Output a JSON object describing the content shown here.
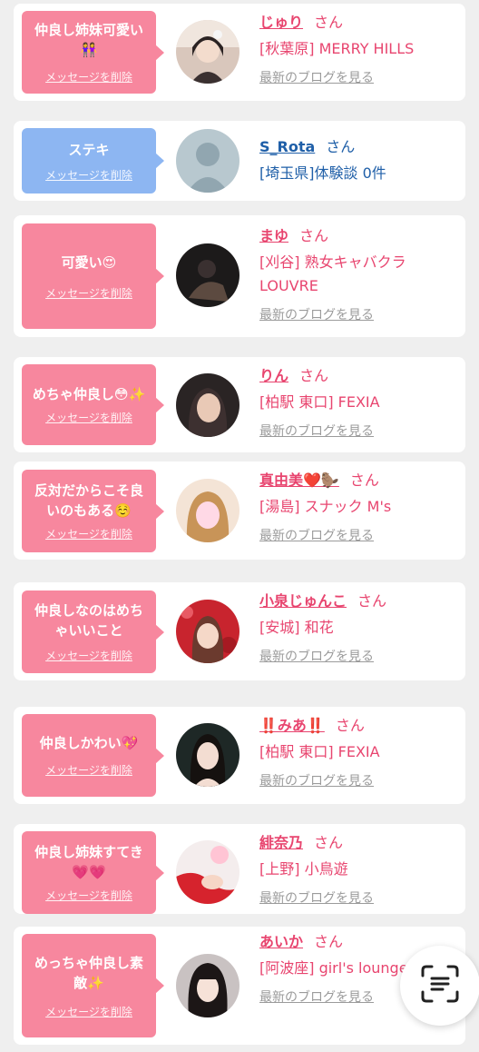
{
  "delete_label": "メッセージを削除",
  "blog_label": "最新のブログを見る",
  "honorific": "さん",
  "colors": {
    "pink": "#f7879e",
    "blue": "#8db6f2",
    "name_pink": "#e8456f",
    "name_blue": "#1f5fa8"
  },
  "messages": [
    {
      "text": "仲良し姉妹可愛い👭",
      "name": "じゅり",
      "shop": "[秋葉原] MERRY HILLS",
      "blog": true,
      "color": "pink"
    },
    {
      "text": "ステキ",
      "name": "S_Rota",
      "shop": "[埼玉県]体験談 0件",
      "blog": false,
      "color": "blue"
    },
    {
      "text": "可愛い😍",
      "name": "まゆ",
      "shop": "[刈谷] 熟女キャバクラLOUVRE",
      "blog": true,
      "color": "pink"
    },
    {
      "text": "めちゃ仲良し😳✨",
      "name": "りん",
      "shop": "[柏駅 東口] FEXIA",
      "blog": true,
      "color": "pink"
    },
    {
      "text": "反対だからこそ良いのもある☺️",
      "name": "真由美❤️🦫",
      "shop": "[湯島] スナック M's",
      "blog": true,
      "color": "pink"
    },
    {
      "text": "仲良しなのはめちゃいいこと",
      "name": "小泉じゅんこ",
      "shop": "[安城] 和花",
      "blog": true,
      "color": "pink"
    },
    {
      "text": "仲良しかわい💖",
      "name": "‼️みあ‼️",
      "shop": "[柏駅 東口] FEXIA",
      "blog": true,
      "color": "pink"
    },
    {
      "text": "仲良し姉妹すてき💗💗",
      "name": "緋奈乃",
      "shop": "[上野] 小鳥遊",
      "blog": true,
      "color": "pink"
    },
    {
      "text": "めっちゃ仲良し素敵✨",
      "name": "あいか",
      "shop": "[阿波座] girl's lounge KreA",
      "blog": true,
      "color": "pink"
    }
  ]
}
